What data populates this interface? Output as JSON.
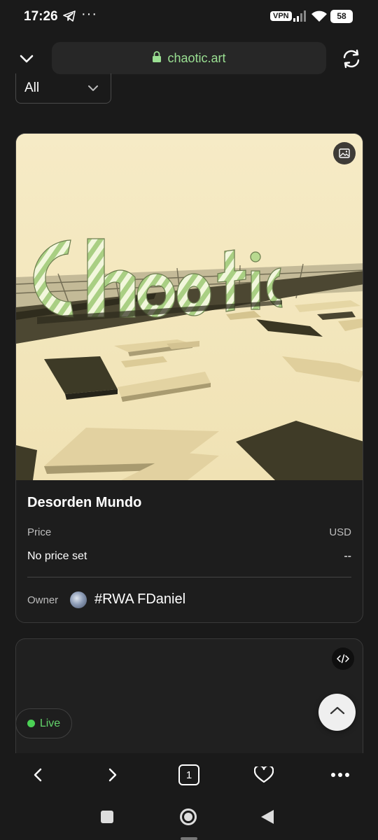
{
  "status_bar": {
    "time": "17:26",
    "overflow": "···",
    "vpn": "VPN",
    "battery": "58",
    "icons": [
      "telegram-icon",
      "signal-icon",
      "wifi-icon",
      "battery-icon"
    ]
  },
  "browser": {
    "url": "chaotic.art",
    "icons": [
      "chevron-down-icon",
      "lock-icon",
      "refresh-icon"
    ],
    "accent_color": "#9adf92"
  },
  "filter": {
    "selected": "All"
  },
  "cards": [
    {
      "artwork_text": "Chaotic",
      "media_icon": "image-icon",
      "title": "Desorden Mundo",
      "price_label": "Price",
      "currency_label": "USD",
      "price_value": "No price set",
      "price_usd": "--",
      "owner_label": "Owner",
      "owner_name": "#RWA FDaniel",
      "colors": {
        "background": "#f4e8c1",
        "block": "#4a4630",
        "letter_green": "#b5d98f"
      }
    },
    {
      "media_icon": "code-icon",
      "status": "Live",
      "status_color": "#4bd155"
    }
  ],
  "floating": {
    "scroll_top_icon": "chevron-up-icon"
  },
  "bottom_nav": {
    "tab_count": "1",
    "icons": [
      "back-icon",
      "forward-icon",
      "tabs-icon",
      "heart-icon",
      "more-icon"
    ]
  },
  "system_nav": {
    "icons": [
      "recents-icon",
      "home-icon",
      "back-triangle-icon"
    ]
  }
}
